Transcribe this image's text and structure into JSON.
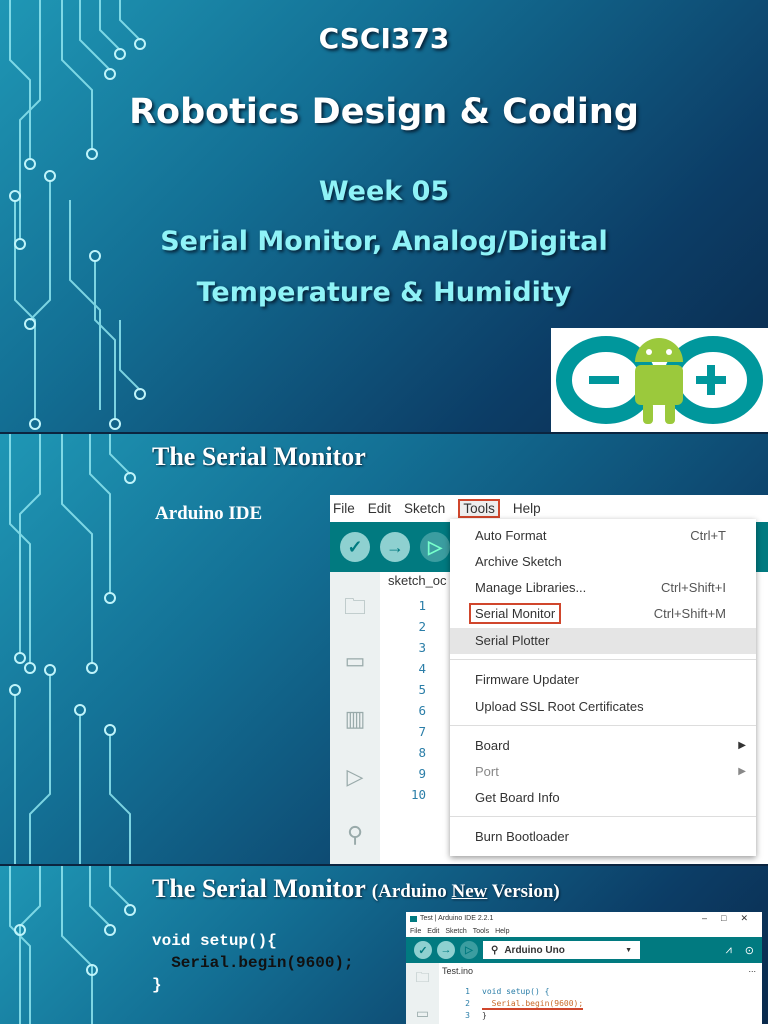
{
  "slide1": {
    "course": "CSCI373",
    "title": "Robotics Design & Coding",
    "week": "Week 05",
    "subtitle1": "Serial Monitor, Analog/Digital",
    "subtitle2": "Temperature & Humidity"
  },
  "slide2": {
    "title": "The Serial Monitor",
    "label": "Arduino IDE",
    "menubar": [
      "File",
      "Edit",
      "Sketch",
      "Tools",
      "Help"
    ],
    "tab": "sketch_oc",
    "line_numbers": "1\n2\n3\n4\n5\n6\n7\n8\n9\n10",
    "menu": [
      {
        "label": "Auto Format",
        "shortcut": "Ctrl+T"
      },
      {
        "label": "Archive Sketch",
        "shortcut": ""
      },
      {
        "label": "Manage Libraries...",
        "shortcut": "Ctrl+Shift+I"
      },
      {
        "label": "Serial Monitor",
        "shortcut": "Ctrl+Shift+M"
      },
      {
        "label": "Serial Plotter",
        "shortcut": ""
      },
      {
        "label": "Firmware Updater",
        "shortcut": ""
      },
      {
        "label": "Upload SSL Root Certificates",
        "shortcut": ""
      },
      {
        "label": "Board",
        "shortcut": ""
      },
      {
        "label": "Port",
        "shortcut": ""
      },
      {
        "label": "Get Board Info",
        "shortcut": ""
      },
      {
        "label": "Burn Bootloader",
        "shortcut": ""
      }
    ]
  },
  "slide3": {
    "title": "The Serial Monitor",
    "title_pre": "(Arduino ",
    "title_new": "New",
    "title_post": " Version)",
    "code": [
      "void setup(){",
      "  Serial.begin(9600);",
      "}"
    ],
    "ide": {
      "window_title": "Test | Arduino IDE 2.2.1",
      "menubar": [
        "File",
        "Edit",
        "Sketch",
        "Tools",
        "Help"
      ],
      "board": "Arduino Uno",
      "tab": "Test.ino",
      "more": "...",
      "lines": [
        {
          "n": "1",
          "code": "void setup() {"
        },
        {
          "n": "2",
          "code": "  Serial.begin(9600);"
        },
        {
          "n": "3",
          "code": "}"
        }
      ]
    }
  }
}
